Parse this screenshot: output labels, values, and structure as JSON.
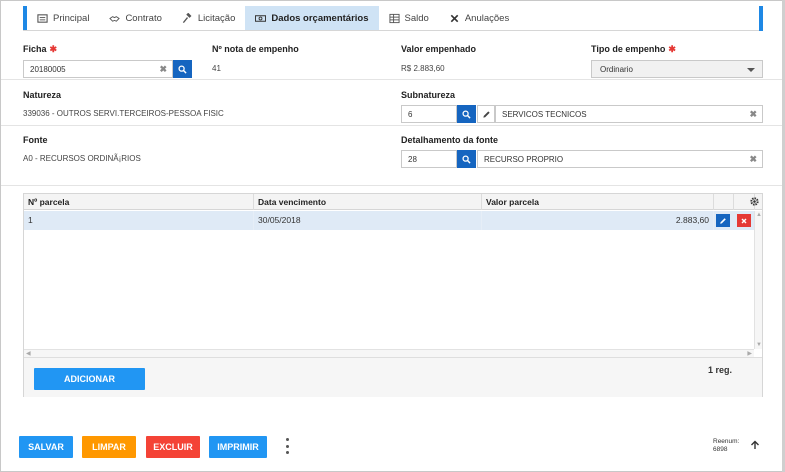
{
  "tabs": [
    {
      "label": "Principal",
      "icon": "grid-icon",
      "active": false
    },
    {
      "label": "Contrato",
      "icon": "handshake-icon",
      "active": false
    },
    {
      "label": "Licitação",
      "icon": "gavel-icon",
      "active": false
    },
    {
      "label": "Dados orçamentários",
      "icon": "money-icon",
      "active": true
    },
    {
      "label": "Saldo",
      "icon": "table-icon",
      "active": false
    },
    {
      "label": "Anulações",
      "icon": "x-icon",
      "active": false
    }
  ],
  "form": {
    "ficha": {
      "label": "Ficha",
      "required_mark": "✱",
      "value": "20180005"
    },
    "nota": {
      "label": "Nº nota de empenho",
      "value": "41"
    },
    "valor_empenhado": {
      "label": "Valor empenhado",
      "value": "R$ 2.883,60"
    },
    "tipo_empenho": {
      "label": "Tipo de empenho",
      "required_mark": "✱",
      "selected": "Ordinario"
    },
    "natureza": {
      "label": "Natureza",
      "value": "339036 - OUTROS SERVI.TERCEIROS-PESSOA FISIC"
    },
    "subnatureza": {
      "label": "Subnatureza",
      "code": "6",
      "description": "SERVICOS TECNICOS"
    },
    "fonte": {
      "label": "Fonte",
      "value": "A0 - RECURSOS ORDINÃ¡RIOS"
    },
    "detalhamento": {
      "label": "Detalhamento da fonte",
      "code": "28",
      "description": "RECURSO PROPRIO"
    }
  },
  "grid": {
    "columns": [
      "Nº parcela",
      "Data vencimento",
      "Valor parcela"
    ],
    "rows": [
      {
        "parcela": "1",
        "vencimento": "30/05/2018",
        "valor": "2.883,60"
      }
    ],
    "add_label": "ADICIONAR",
    "count_label": "1 reg."
  },
  "actions": {
    "save": "SALVAR",
    "clear": "LIMPAR",
    "delete": "EXCLUIR",
    "print": "IMPRIMIR"
  },
  "footer": {
    "reenum_label": "Reenum:",
    "reenum_value": "6898"
  },
  "colors": {
    "accent": "#1e88e5",
    "search_button": "#1565c0",
    "save": "#2196f3",
    "clear": "#ff9800",
    "delete": "#f44336",
    "active_tab": "#cfe3f5"
  }
}
